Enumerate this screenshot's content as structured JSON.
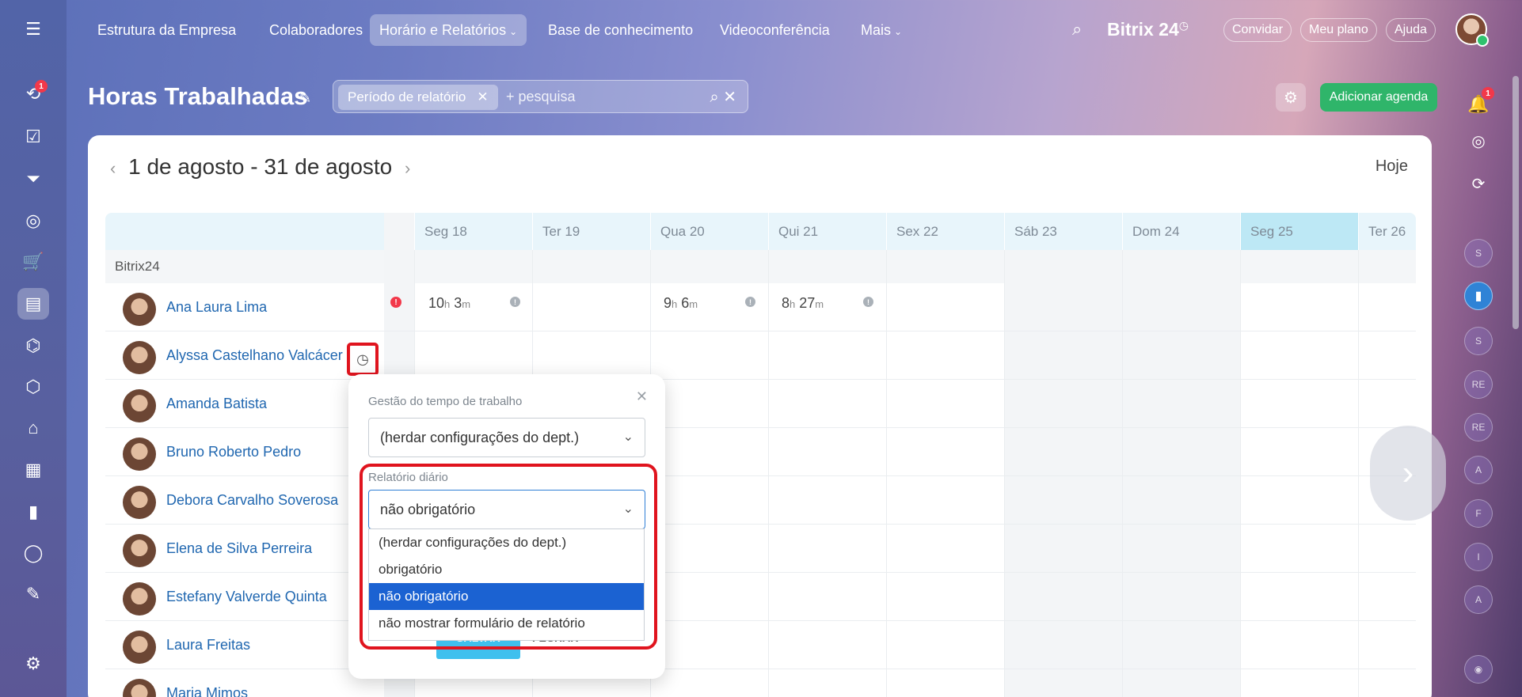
{
  "leftbar": {
    "items": [
      {
        "icon": "menu-icon",
        "glyph": "☰"
      },
      {
        "icon": "activity-icon",
        "glyph": "⟲",
        "badge": "1"
      },
      {
        "icon": "tasks-icon",
        "glyph": "☑"
      },
      {
        "icon": "funnel-icon",
        "glyph": "⏷"
      },
      {
        "icon": "target-icon",
        "glyph": "◎"
      },
      {
        "icon": "cart-icon",
        "glyph": "🛒"
      },
      {
        "icon": "contact-card-icon",
        "glyph": "▤"
      },
      {
        "icon": "robot-icon",
        "glyph": "⌬"
      },
      {
        "icon": "box-icon",
        "glyph": "⬡"
      },
      {
        "icon": "store-icon",
        "glyph": "⌂"
      },
      {
        "icon": "calendar-icon",
        "glyph": "▦"
      },
      {
        "icon": "chart-icon",
        "glyph": "▮"
      },
      {
        "icon": "shield-icon",
        "glyph": "◯"
      },
      {
        "icon": "document-icon",
        "glyph": "✎"
      },
      {
        "icon": "settings-icon",
        "glyph": "⚙"
      }
    ]
  },
  "topnav": {
    "items": [
      "Estrutura da Empresa",
      "Colaboradores",
      "Horário e Relatórios",
      "Base de conhecimento",
      "Videoconferência",
      "Mais"
    ],
    "brand": "Bitrix 24",
    "brand_glyph": "◷",
    "search_glyph": "⌕",
    "invite": "Convidar",
    "plan": "Meu plano",
    "help": "Ajuda"
  },
  "header": {
    "title": "Horas Trabalhadas",
    "pin_glyph": "✎",
    "filter_chip": "Período de relatório",
    "search_placeholder": "+ pesquisa",
    "search_icons": "⌕ ✕",
    "add_button": "Adicionar agenda",
    "settings_glyph": "⚙"
  },
  "rightbar": {
    "bell_badge": "1",
    "circles": [
      "S",
      "",
      "S",
      "RE",
      "RE",
      "A",
      "F",
      "I",
      "A",
      ""
    ]
  },
  "calendar": {
    "range": "1 de agosto - 31 de agosto",
    "prev": "‹",
    "next": "›",
    "today_button": "Hoje",
    "columns": [
      "Seg 18",
      "Ter 19",
      "Qua 20",
      "Qui 21",
      "Sex 22",
      "Sáb 23",
      "Dom 24",
      "Seg 25",
      "Ter 26"
    ],
    "group": "Bitrix24",
    "employees": [
      "Ana Laura Lima",
      "Alyssa Castelhano Valcácer",
      "Amanda Batista",
      "Bruno Roberto Pedro",
      "Debora Carvalho Soverosa",
      "Elena de Silva Perreira",
      "Estefany Valverde Quinta",
      "Laura Freitas",
      "Maria Mimos"
    ],
    "times": [
      {
        "h": "10",
        "m": "3"
      },
      {
        "h": "9",
        "m": "6"
      },
      {
        "h": "8",
        "m": "27"
      }
    ],
    "unit_h": "h",
    "unit_m": "m"
  },
  "popup": {
    "label_time_mgmt": "Gestão do tempo de trabalho",
    "time_mgmt_value": "(herdar configurações do dept.)",
    "label_daily": "Relatório diário",
    "daily_value": "não obrigatório",
    "options": [
      "(herdar configurações do dept.)",
      "obrigatório",
      "não obrigatório",
      "não mostrar formulário de relatório"
    ],
    "selected_option": "não obrigatório",
    "save": "SALVAR",
    "close": "FECHAR"
  },
  "colors": {
    "accent_green": "#2fb56a",
    "highlight_red": "#e0141e",
    "selected_blue": "#1b62d2",
    "link_blue": "#2067b0"
  }
}
